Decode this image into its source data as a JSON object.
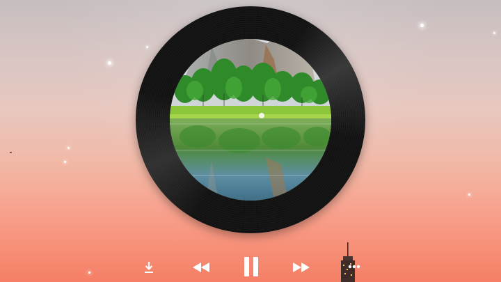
{
  "player": {
    "artwork": {
      "subject": "landscape-lake-reflection"
    },
    "controls": {
      "download_icon": "download-icon",
      "previous_icon": "rewind-icon",
      "pause_icon": "pause-icon",
      "next_icon": "fast-forward-icon",
      "more_icon": "more-dots-icon"
    },
    "state": {
      "playing": true
    }
  },
  "colors": {
    "sky_top": "#c6bebf",
    "sky_bottom": "#f47f66",
    "record": "#111111",
    "control_icon": "#ffffff"
  }
}
